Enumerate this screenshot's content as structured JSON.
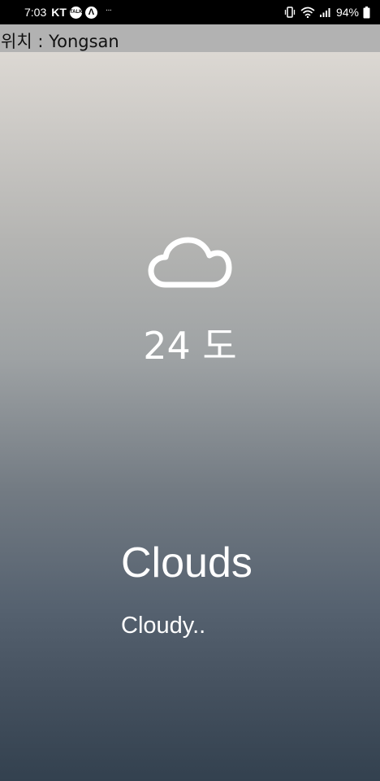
{
  "status_bar": {
    "time": "7:03",
    "carrier": "KT",
    "notifications": [
      "talk-icon",
      "a-icon"
    ],
    "more": "···",
    "battery_percent": "94%",
    "icons": [
      "vibrate-icon",
      "wifi-icon",
      "signal-icon",
      "battery-icon"
    ]
  },
  "header": {
    "location_label": "위치 : Yongsan",
    "background": "#b2b2b2"
  },
  "weather": {
    "icon": "cloud-icon",
    "temperature": "24 도",
    "main": "Clouds",
    "description": "Cloudy..",
    "gradient_top": "#dcd8d3",
    "gradient_bottom": "#33414f"
  }
}
